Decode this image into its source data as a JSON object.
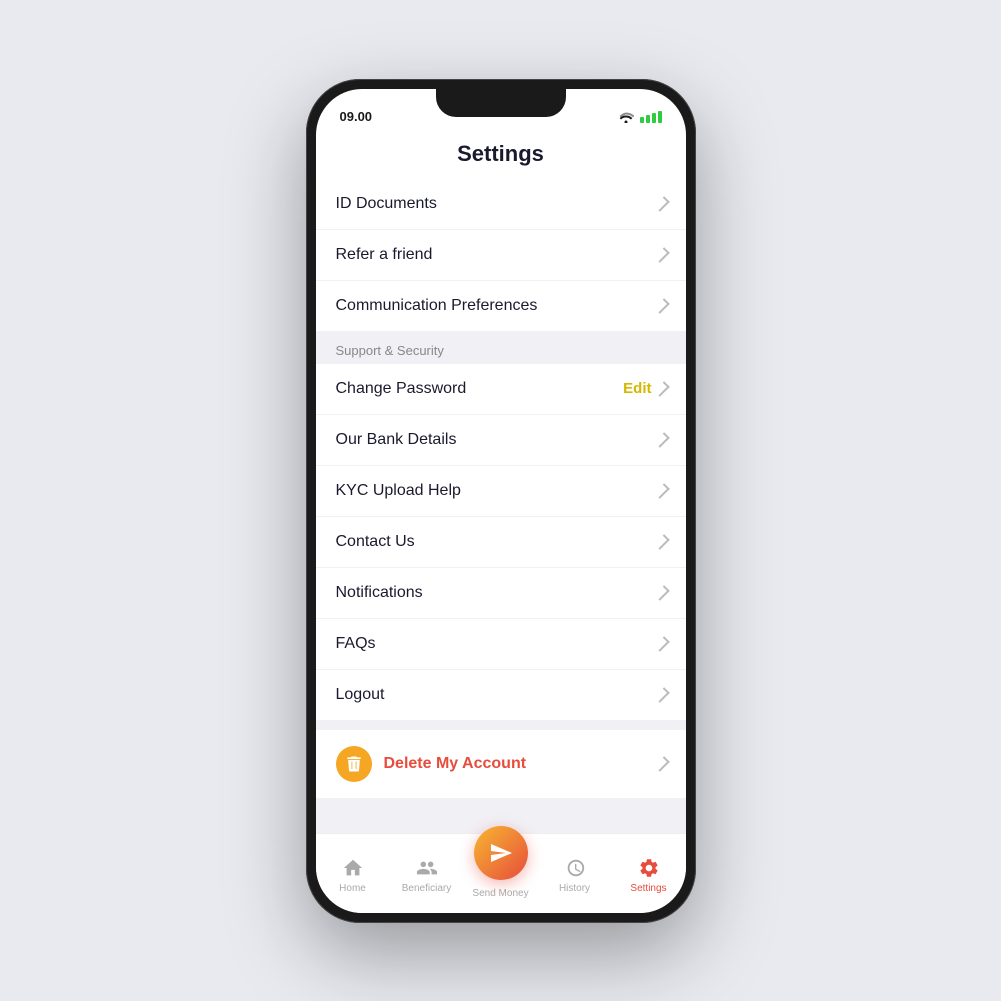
{
  "statusBar": {
    "time": "09.00",
    "wifi": true,
    "battery": true
  },
  "page": {
    "title": "Settings"
  },
  "topSection": {
    "items": [
      {
        "id": "id-documents",
        "label": "ID Documents",
        "hasChevron": true
      },
      {
        "id": "refer-friend",
        "label": "Refer a friend",
        "hasChevron": true
      },
      {
        "id": "communication-prefs",
        "label": "Communication Preferences",
        "hasChevron": true
      }
    ]
  },
  "supportSection": {
    "label": "Support & Security",
    "items": [
      {
        "id": "change-password",
        "label": "Change Password",
        "editLabel": "Edit",
        "hasChevron": true
      },
      {
        "id": "bank-details",
        "label": "Our Bank Details",
        "hasChevron": true
      },
      {
        "id": "kyc-upload",
        "label": "KYC Upload Help",
        "hasChevron": true
      },
      {
        "id": "contact-us",
        "label": "Contact Us",
        "hasChevron": true
      },
      {
        "id": "notifications",
        "label": "Notifications",
        "hasChevron": true
      },
      {
        "id": "faqs",
        "label": "FAQs",
        "hasChevron": true
      },
      {
        "id": "logout",
        "label": "Logout",
        "hasChevron": true
      }
    ]
  },
  "deleteSection": {
    "label": "Delete My Account",
    "hasChevron": true
  },
  "bottomNav": {
    "items": [
      {
        "id": "home",
        "label": "Home",
        "icon": "🏠",
        "active": false
      },
      {
        "id": "beneficiary",
        "label": "Beneficiary",
        "icon": "👥",
        "active": false
      },
      {
        "id": "send-money",
        "label": "Send\nMoney",
        "icon": "✈",
        "active": false,
        "fab": true
      },
      {
        "id": "history",
        "label": "History",
        "icon": "🕐",
        "active": false
      },
      {
        "id": "settings",
        "label": "Settings",
        "icon": "⚙",
        "active": true
      }
    ]
  },
  "colors": {
    "accent": "#e74c3c",
    "edit": "#d4b800",
    "deleteRed": "#e74c3c",
    "deleteIcon": "#f5a623",
    "activeNav": "#e74c3c"
  }
}
